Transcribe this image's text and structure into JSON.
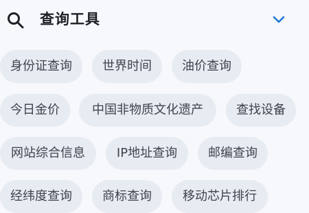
{
  "header": {
    "title": "查询工具",
    "icon": "search-icon",
    "toggle_icon": "chevron-down-icon",
    "accent_color": "#1e78d6"
  },
  "tools": [
    "身份证查询",
    "世界时间",
    "油价查询",
    "今日金价",
    "中国非物质文化遗产",
    "查找设备",
    "网站综合信息",
    "IP地址查询",
    "邮编查询",
    "经纬度查询",
    "商标查询",
    "移动芯片排行"
  ]
}
